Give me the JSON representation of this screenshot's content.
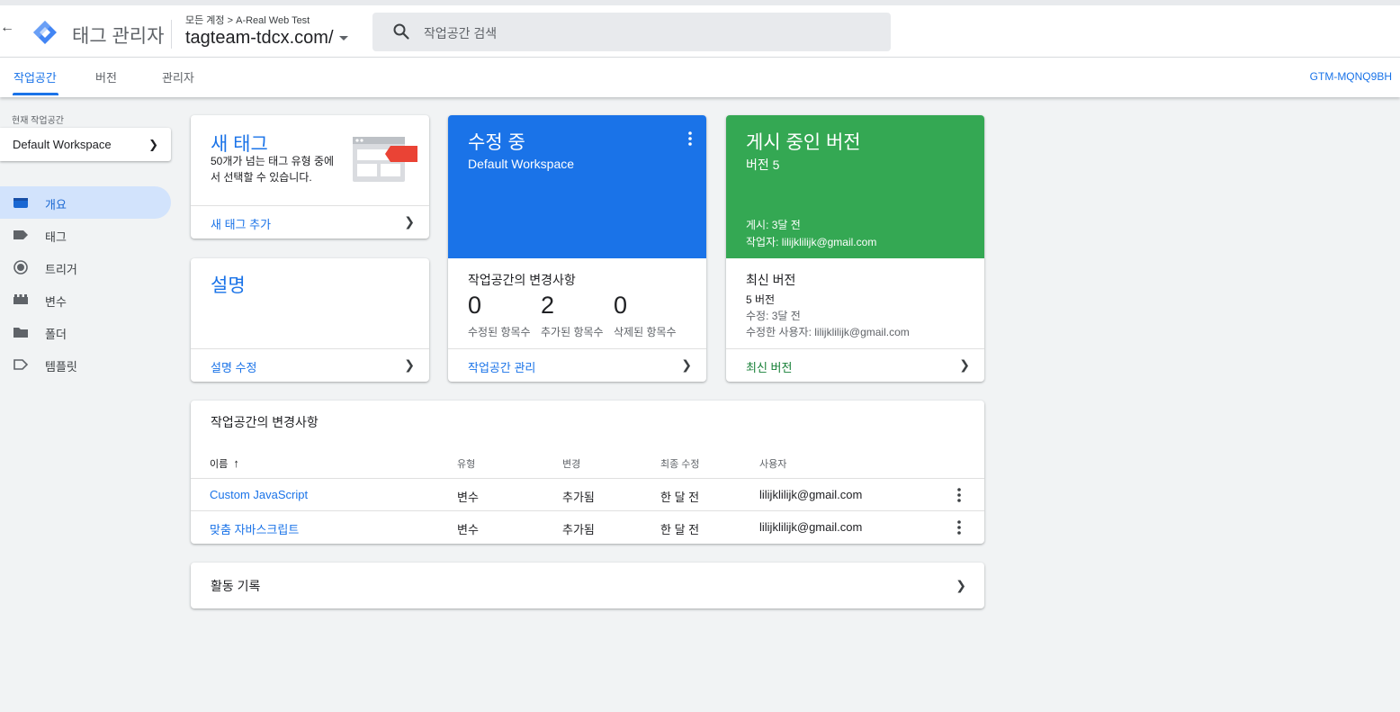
{
  "header": {
    "back_icon": "arrow-left-icon",
    "app_title": "태그 관리자",
    "breadcrumb": {
      "root": "모든 계정",
      "separator": ">",
      "account": "A-Real Web Test"
    },
    "container_name": "tagteam-tdcx.com/",
    "search_placeholder": "작업공간 검색"
  },
  "tabs": [
    {
      "label": "작업공간",
      "active": true
    },
    {
      "label": "버전",
      "active": false
    },
    {
      "label": "관리자",
      "active": false
    }
  ],
  "container_id": "GTM-MQNQ9BH",
  "sidebar": {
    "current_workspace_label": "현재 작업공간",
    "workspace_name": "Default Workspace",
    "items": [
      {
        "label": "개요",
        "icon": "overview-icon",
        "active": true
      },
      {
        "label": "태그",
        "icon": "tag-icon",
        "active": false
      },
      {
        "label": "트리거",
        "icon": "trigger-icon",
        "active": false
      },
      {
        "label": "변수",
        "icon": "variable-icon",
        "active": false
      },
      {
        "label": "폴더",
        "icon": "folder-icon",
        "active": false
      },
      {
        "label": "템플릿",
        "icon": "template-icon",
        "active": false
      }
    ]
  },
  "new_tag_card": {
    "title": "새 태그",
    "description": "50개가 넘는 태그 유형 중에서 선택할 수 있습니다.",
    "action": "새 태그 추가"
  },
  "description_card": {
    "title": "설명",
    "action": "설명 수정"
  },
  "editing_card": {
    "title": "수정 중",
    "workspace": "Default Workspace",
    "changes_title": "작업공간의 변경사항",
    "stats": [
      {
        "value": "0",
        "label": "수정된 항목수"
      },
      {
        "value": "2",
        "label": "추가된 항목수"
      },
      {
        "value": "0",
        "label": "삭제된 항목수"
      }
    ],
    "action": "작업공간 관리"
  },
  "live_version_card": {
    "title": "게시 중인 버전",
    "version": "버전 5",
    "published": "게시: 3달 전",
    "author": "작업자: lilijklilijk@gmail.com",
    "latest_title": "최신 버전",
    "latest_version": "5 버전",
    "modified": "수정: 3달 전",
    "modified_by": "수정한 사용자: lilijklilijk@gmail.com",
    "action": "최신 버전"
  },
  "changes_table": {
    "title": "작업공간의 변경사항",
    "headers": {
      "name": "이름",
      "type": "유형",
      "change": "변경",
      "last_modified": "최종 수정",
      "user": "사용자"
    },
    "sort_icon": "arrow-up-icon",
    "rows": [
      {
        "name": "Custom JavaScript",
        "type": "변수",
        "change": "추가됨",
        "last_modified": "한 달 전",
        "user": "lilijklilijk@gmail.com"
      },
      {
        "name": "맞춤 자바스크립트",
        "type": "변수",
        "change": "추가됨",
        "last_modified": "한 달 전",
        "user": "lilijklilijk@gmail.com"
      }
    ]
  },
  "activity": {
    "label": "활동 기록"
  },
  "colors": {
    "primary": "#1a73e8",
    "live_green": "#34a853",
    "link_green": "#188038",
    "nav_active": "#d2e3fc"
  }
}
